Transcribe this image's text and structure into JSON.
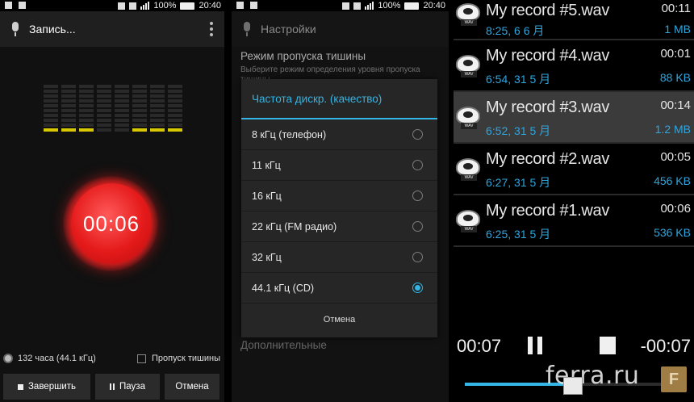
{
  "status": {
    "battery": "100%",
    "time": "20:40"
  },
  "recorder": {
    "title": "Запись...",
    "timer": "00:06",
    "storage_info": "132 часа (44.1 кГц)",
    "skip_silence_label": "Пропуск тишины",
    "finish_label": "Завершить",
    "pause_label": "Пауза",
    "cancel_label": "Отмена",
    "meter_levels": [
      1,
      1,
      1,
      0,
      0,
      1,
      1,
      1
    ]
  },
  "settings": {
    "title": "Настройки",
    "bg_item_title": "Режим пропуска тишины",
    "bg_item_subtitle": "Выберите режим определения уровня пропуска тишины",
    "bg_bottom": "Дополнительные",
    "dialog": {
      "title": "Частота дискр. (качество)",
      "options": [
        {
          "label": "8 кГц (телефон)",
          "selected": false
        },
        {
          "label": "11 кГц",
          "selected": false
        },
        {
          "label": "16 кГц",
          "selected": false
        },
        {
          "label": "22 кГц (FM радио)",
          "selected": false
        },
        {
          "label": "32 кГц",
          "selected": false
        },
        {
          "label": "44.1 кГц (CD)",
          "selected": true
        }
      ],
      "cancel": "Отмена"
    }
  },
  "records": {
    "items": [
      {
        "name": "My record #5.wav",
        "date": "8:25, 6 6 月",
        "duration": "00:11",
        "size": "1 MB",
        "selected": false
      },
      {
        "name": "My record #4.wav",
        "date": "6:54, 31 5 月",
        "duration": "00:01",
        "size": "88 KB",
        "selected": false
      },
      {
        "name": "My record #3.wav",
        "date": "6:52, 31 5 月",
        "duration": "00:14",
        "size": "1.2 MB",
        "selected": true
      },
      {
        "name": "My record #2.wav",
        "date": "6:27, 31 5 月",
        "duration": "00:05",
        "size": "456 KB",
        "selected": false
      },
      {
        "name": "My record #1.wav",
        "date": "6:25, 31 5 月",
        "duration": "00:06",
        "size": "536 KB",
        "selected": false
      }
    ],
    "icon_tag": "WAV",
    "player": {
      "position": "00:07",
      "remaining": "-00:07",
      "progress": 0.5
    }
  },
  "watermark": {
    "text": "ferra.ru",
    "logo": "F"
  },
  "colors": {
    "accent": "#33b5e5",
    "record_red": "#e51a1a",
    "meter_yellow": "#d7c800"
  }
}
